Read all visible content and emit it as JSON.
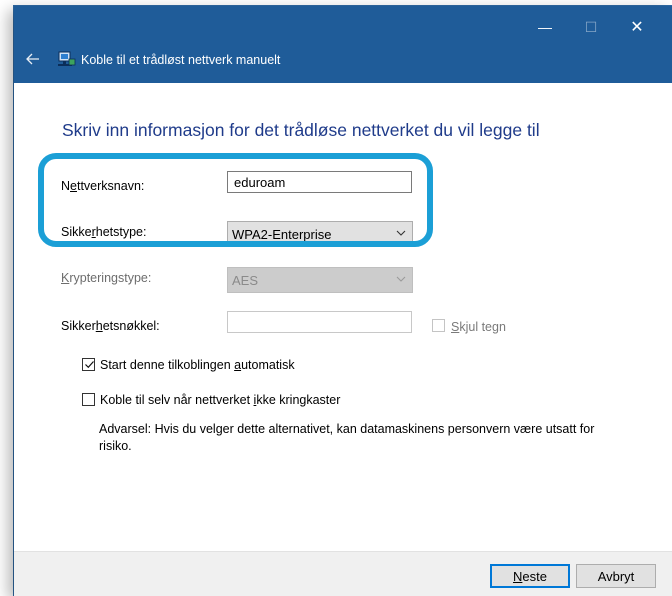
{
  "window": {
    "title": "Koble til et trådløst nettverk manuelt",
    "controls": {
      "minimize": "—",
      "maximize": "☐",
      "close": "✕"
    }
  },
  "heading": "Skriv inn informasjon for det trådløse nettverket du vil legge til",
  "form": {
    "network_name": {
      "label_pre": "N",
      "label_ul": "e",
      "label_post": "ttverksnavn:",
      "value": "eduroam"
    },
    "security_type": {
      "label_pre": "Sikke",
      "label_ul": "r",
      "label_post": "hetstype:",
      "value": "WPA2-Enterprise"
    },
    "encryption_type": {
      "label_pre": "",
      "label_ul": "K",
      "label_post": "rypteringstype:",
      "value": "AES"
    },
    "security_key": {
      "label_pre": "Sikker",
      "label_ul": "h",
      "label_post": "etsnøkkel:",
      "value": ""
    },
    "hide_chars": {
      "label_pre": "",
      "label_ul": "S",
      "label_post": "kjul tegn",
      "checked": false
    }
  },
  "options": {
    "auto_start": {
      "label_pre": "Start denne tilkoblingen ",
      "label_ul": "a",
      "label_post": "utomatisk",
      "checked": true
    },
    "connect_hidden": {
      "label_pre": "Koble til selv når nettverket ",
      "label_ul": "i",
      "label_post": "kke kringkaster",
      "checked": false
    }
  },
  "warning": "Advarsel: Hvis du velger dette alternativet, kan datamaskinens personvern være utsatt for risiko.",
  "buttons": {
    "next": {
      "label_ul": "N",
      "label_post": "este"
    },
    "cancel": "Avbryt"
  },
  "colors": {
    "titlebar": "#1f5c99",
    "heading": "#1f3b8a",
    "highlight": "#1b9fd6",
    "primary_border": "#0078d7"
  },
  "icons": {
    "back": "arrow-left-icon",
    "network": "network-icon",
    "dropdown": "chevron-down-icon",
    "check": "checkmark-icon"
  }
}
